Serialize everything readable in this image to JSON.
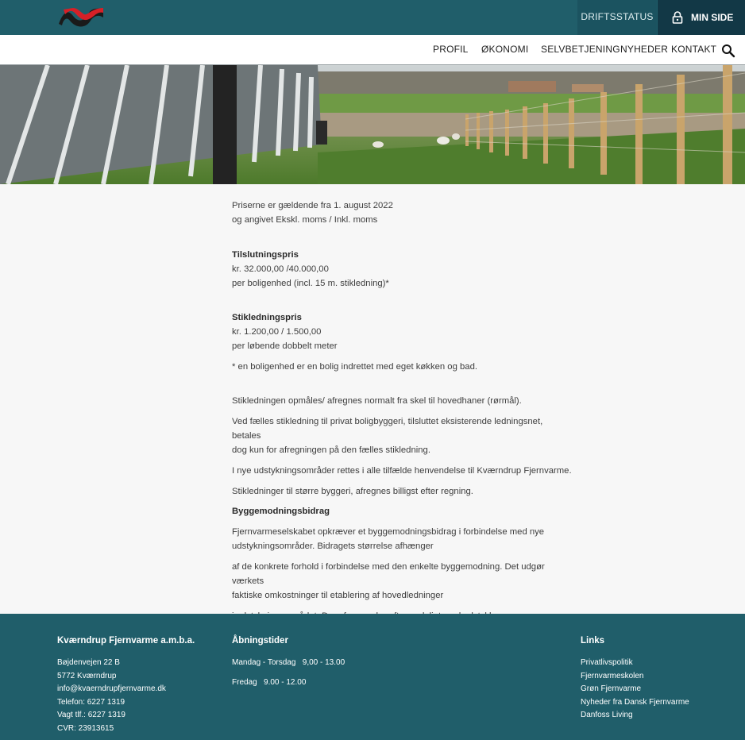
{
  "header": {
    "driftsstatus": "DRIFTSSTATUS",
    "min_side": "MIN SIDE"
  },
  "nav": {
    "items": [
      "PROFIL",
      "ØKONOMI",
      "SELVBETJENING",
      "NYHEDER",
      "KONTAKT"
    ]
  },
  "icons": {
    "logo": "company-logo",
    "lock": "lock-icon",
    "search": "search-icon"
  },
  "colors": {
    "header_bg": "#205e6a",
    "driftsstatus_bg": "#1b5360",
    "min_side_bg": "#123846",
    "footer_bg": "#205e6a",
    "logo_red": "#d62027",
    "logo_black": "#1a1a1a"
  },
  "content": {
    "intro_1": "Priserne er gældende fra 1. august 2022",
    "intro_2": "og angivet Ekskl. moms / Inkl. moms",
    "tilslutning_title": "Tilslutningspris",
    "tilslutning_price": "kr. 32.000,00 /40.000,00",
    "tilslutning_note": "per boligenhed (incl. 15 m. stikledning)*",
    "stik_title": "Stikledningspris",
    "stik_price": "kr. 1.200,00 / 1.500,00",
    "stik_note": "per løbende dobbelt meter",
    "footnote": "* en boligenhed er en bolig indrettet med eget køkken og bad.",
    "p1": "Stikledningen opmåles/ afregnes normalt fra skel til hovedhaner (rørmål).",
    "p2a": "Ved fælles stikledning til privat boligbyggeri, tilsluttet eksisterende ledningsnet, betales",
    "p2b": "dog kun for afregningen på den fælles stikledning.",
    "p3": "I nye udstykningsområder rettes i alle tilfælde henvendelse til Kværndrup Fjernvarme.",
    "p4": "Stikledninger til større byggeri, afregnes billigst efter regning.",
    "bygge_title": "Byggemodningsbidrag",
    "p5a": "Fjernvarmeselskabet opkræver et byggemodningsbidrag i forbindelse med nye",
    "p5b": "udstykningsområder. Bidragets størrelse afhænger",
    "p6a": "af de konkrete forhold i forbindelse med den enkelte byggemodning. Det udgør værkets",
    "p6b": "faktiske omkostninger til etablering af hovedledninger",
    "p7": "i udstykningsområdet. Der afregnes herefter endeligt med udstykkeren"
  },
  "footer": {
    "company": {
      "title": "Kværndrup Fjernvarme a.m.b.a.",
      "lines": [
        "Bøjdenvejen 22 B",
        "5772 Kværndrup",
        "info@kvaerndrupfjernvarme.dk",
        "Telefon: 6227 1319",
        "Vagt tlf.: 6227 1319",
        "CVR: 23913615"
      ]
    },
    "hours": {
      "title": "Åbningstider",
      "lines": [
        "Mandag - Torsdag   9,00 - 13.00",
        "Fredag   9.00 - 12.00"
      ]
    },
    "links": {
      "title": "Links",
      "items": [
        "Privatlivspolitik",
        "Fjernvarmeskolen",
        "Grøn Fjernvarme",
        "Nyheder fra Dansk Fjernvarme",
        "Danfoss Living"
      ]
    }
  }
}
